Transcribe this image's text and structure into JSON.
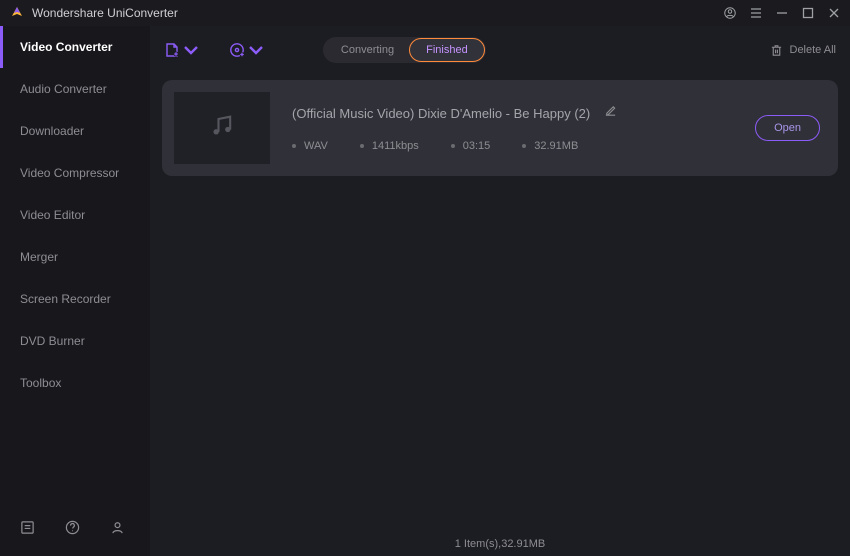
{
  "title": "Wondershare UniConverter",
  "sidebar": {
    "items": [
      {
        "label": "Video Converter",
        "active": true
      },
      {
        "label": "Audio Converter",
        "active": false
      },
      {
        "label": "Downloader",
        "active": false
      },
      {
        "label": "Video Compressor",
        "active": false
      },
      {
        "label": "Video Editor",
        "active": false
      },
      {
        "label": "Merger",
        "active": false
      },
      {
        "label": "Screen Recorder",
        "active": false
      },
      {
        "label": "DVD Burner",
        "active": false
      },
      {
        "label": "Toolbox",
        "active": false
      }
    ]
  },
  "tabs": {
    "converting": "Converting",
    "finished": "Finished",
    "active": "finished"
  },
  "toolbar": {
    "delete_all_label": "Delete All"
  },
  "items": [
    {
      "title": "(Official Music Video) Dixie D'Amelio - Be Happy (2)",
      "format": "WAV",
      "bitrate": "1411kbps",
      "duration": "03:15",
      "size": "32.91MB",
      "open_label": "Open"
    }
  ],
  "status": "1 Item(s),32.91MB"
}
